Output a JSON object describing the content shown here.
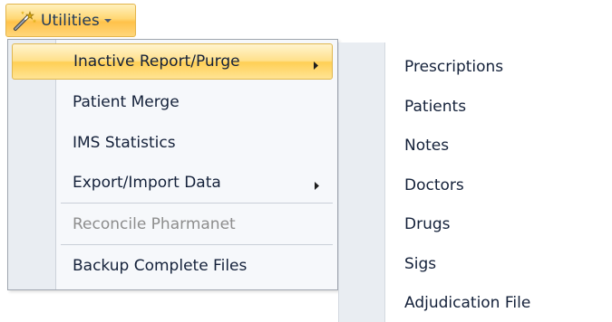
{
  "toolbar": {
    "utilities_label": "Utilities",
    "utilities_icon": "magic-wand-icon",
    "caret_icon": "chevron-down-icon"
  },
  "menu": {
    "items": [
      {
        "label": "Inactive Report/Purge",
        "has_submenu": true,
        "state": "highlighted"
      },
      {
        "label": "Patient Merge",
        "has_submenu": false,
        "state": "enabled"
      },
      {
        "label": "IMS Statistics",
        "has_submenu": false,
        "state": "enabled"
      },
      {
        "label": "Export/Import Data",
        "has_submenu": true,
        "state": "enabled"
      },
      {
        "label": "Reconcile Pharmanet",
        "has_submenu": false,
        "state": "disabled"
      },
      {
        "label": "Backup Complete Files",
        "has_submenu": false,
        "state": "enabled"
      }
    ]
  },
  "submenu": {
    "items": [
      {
        "label": "Prescriptions"
      },
      {
        "label": "Patients"
      },
      {
        "label": "Notes"
      },
      {
        "label": "Doctors"
      },
      {
        "label": "Drugs"
      },
      {
        "label": "Sigs"
      },
      {
        "label": "Adjudication File"
      }
    ]
  },
  "colors": {
    "highlight": "#ffd773",
    "highlight_border": "#e0b74f",
    "text": "#14213a",
    "disabled_text": "#8d8d8d"
  }
}
